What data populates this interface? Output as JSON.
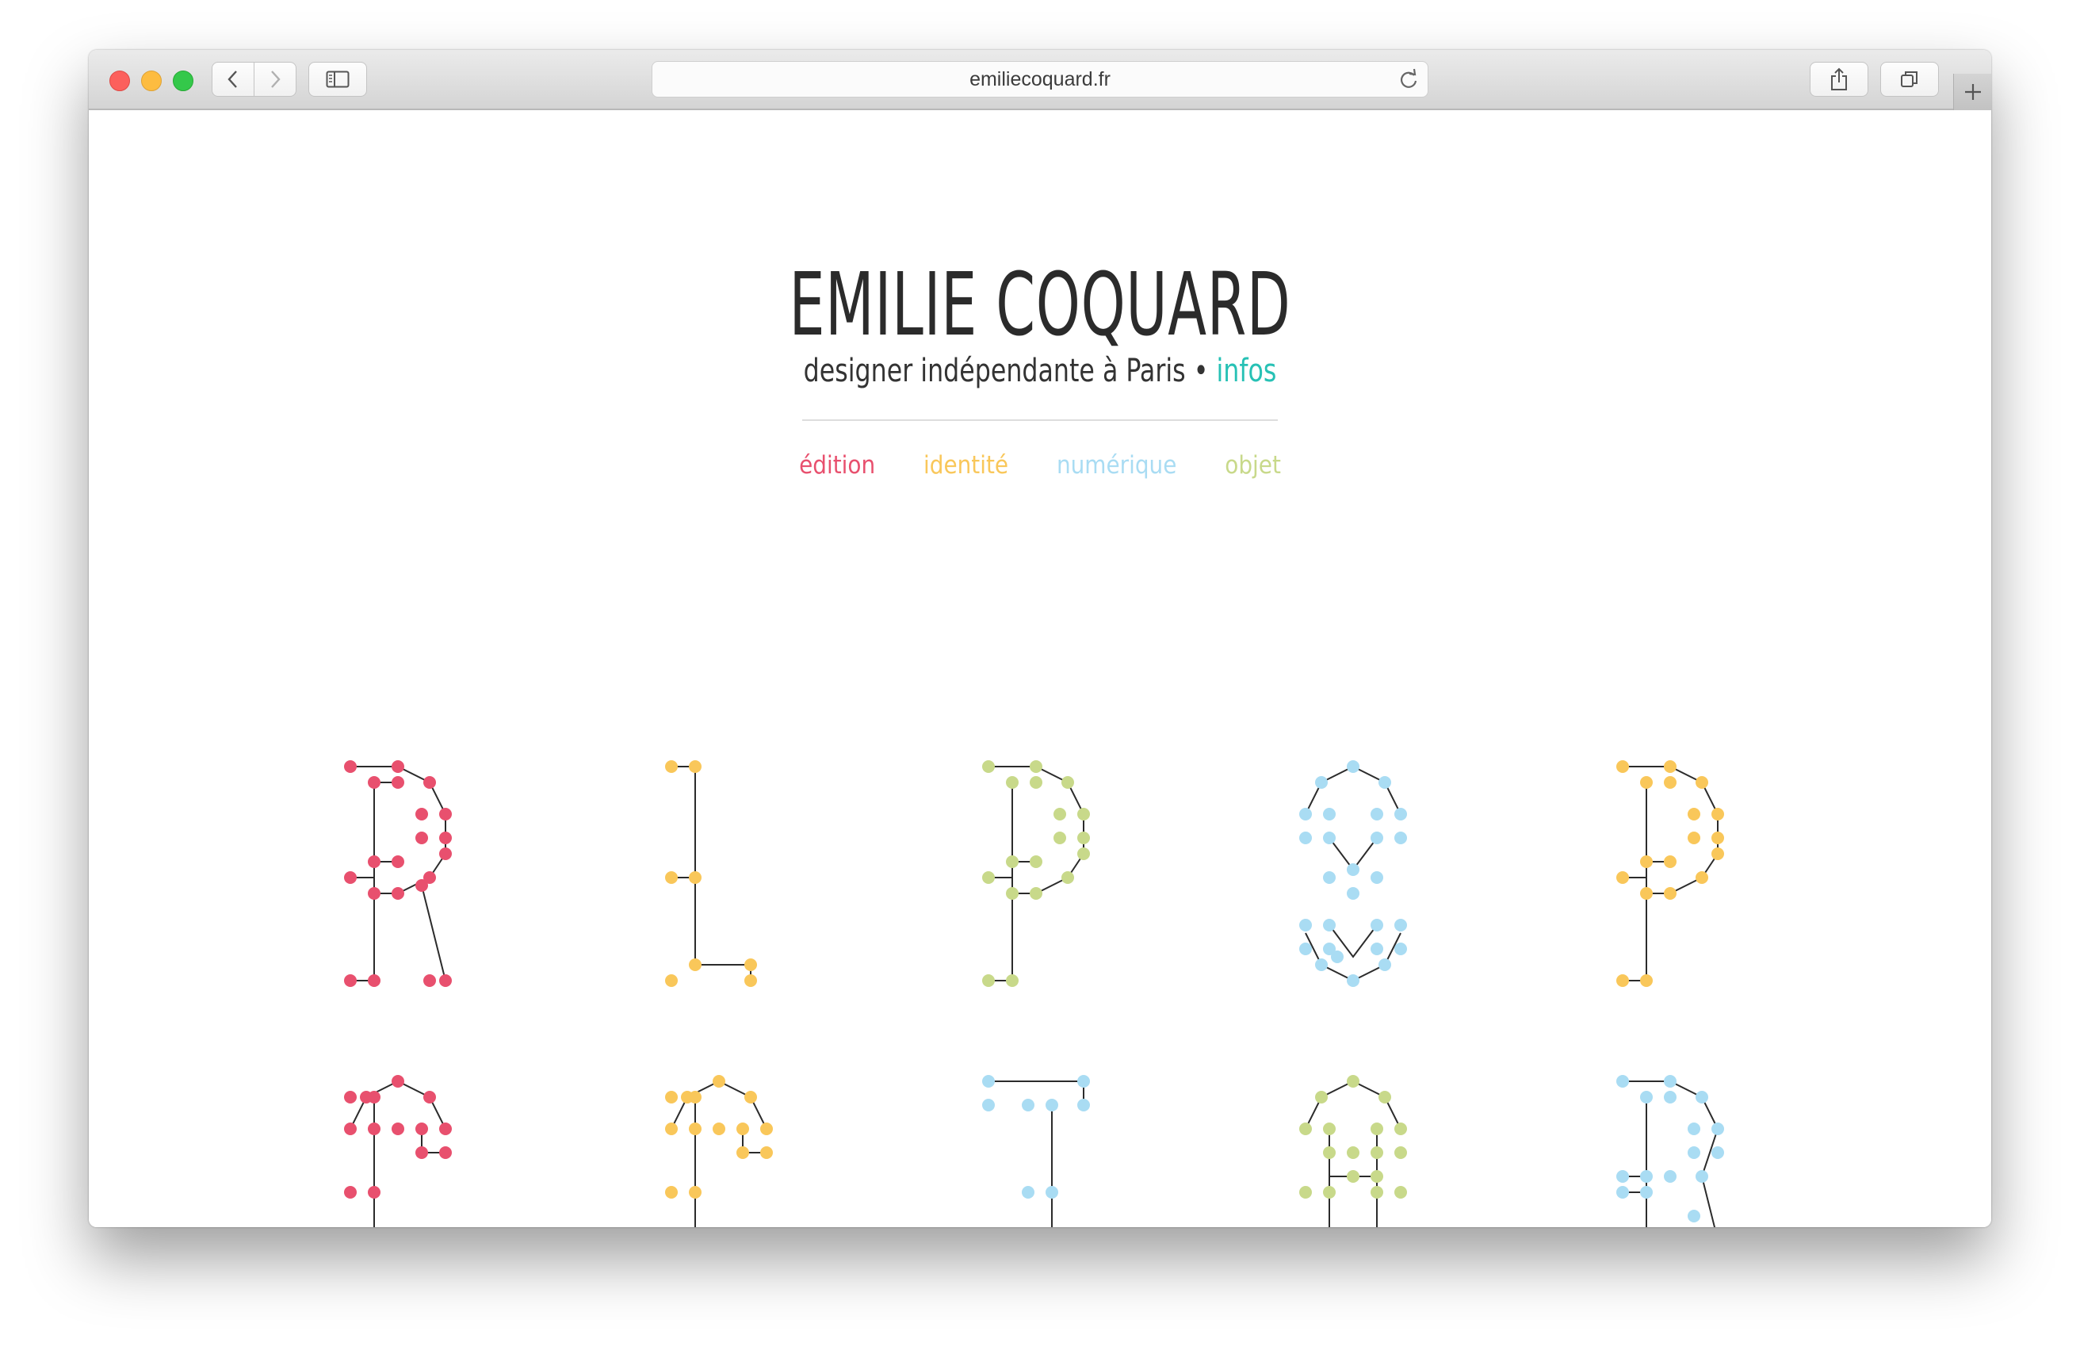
{
  "browser": {
    "url": "emiliecoquard.fr",
    "icons": [
      "back-arrow-icon",
      "forward-arrow-icon",
      "sidebar-icon",
      "reload-icon",
      "share-icon",
      "tabs-icon",
      "plus-icon"
    ]
  },
  "site": {
    "title": "EMILIE COQUARD",
    "tagline_text": "designer indépendante à Paris",
    "tagline_separator": "•",
    "infos_link": "infos"
  },
  "nav": [
    {
      "label": "édition",
      "color": "#e8506e"
    },
    {
      "label": "identité",
      "color": "#f9c75a"
    },
    {
      "label": "numérique",
      "color": "#a9dcf3"
    },
    {
      "label": "objet",
      "color": "#c8d98a"
    }
  ],
  "colors": {
    "text": "#2b2b2b",
    "accent": "#27c1b5",
    "pink": "#e8506e",
    "yellow": "#f9c75a",
    "blue": "#a9dcf3",
    "green": "#c8d98a"
  },
  "thumbnails": [
    {
      "id": "R",
      "color": "#e8506e"
    },
    {
      "id": "L",
      "color": "#f9c75a"
    },
    {
      "id": "P",
      "color": "#c8d98a"
    },
    {
      "id": "8",
      "color": "#a9dcf3"
    },
    {
      "id": "P",
      "color": "#f9c75a"
    },
    {
      "id": "G",
      "color": "#e8506e"
    },
    {
      "id": "G",
      "color": "#f9c75a"
    },
    {
      "id": "T",
      "color": "#a9dcf3"
    },
    {
      "id": "H",
      "color": "#c8d98a"
    },
    {
      "id": "B",
      "color": "#a9dcf3"
    }
  ]
}
